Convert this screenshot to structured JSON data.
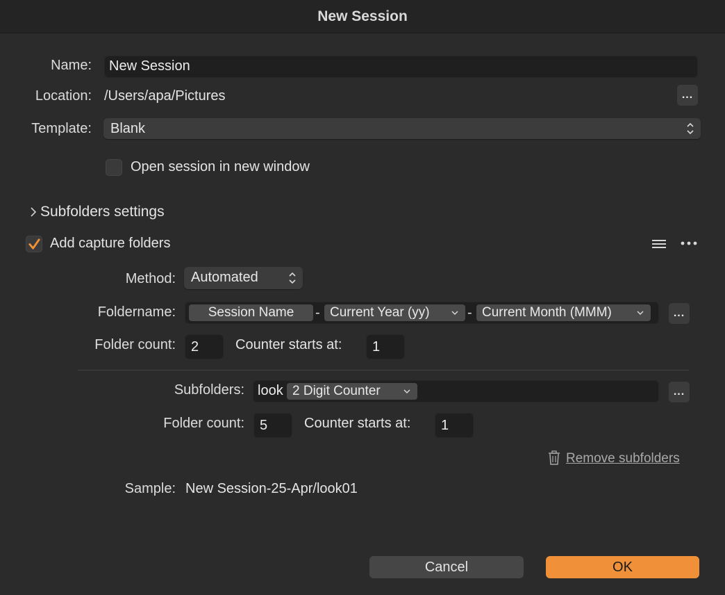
{
  "window": {
    "title": "New Session"
  },
  "form": {
    "name_label": "Name:",
    "name_value": "New Session",
    "location_label": "Location:",
    "location_value": "/Users/apa/Pictures",
    "template_label": "Template:",
    "template_value": "Blank",
    "open_new_window_label": "Open session in new window",
    "open_new_window_checked": false,
    "browse_label": "..."
  },
  "subfolders_settings": {
    "label": "Subfolders settings",
    "expanded": false
  },
  "capture": {
    "add_label": "Add capture folders",
    "checked": true,
    "method_label": "Method:",
    "method_value": "Automated",
    "foldername_label": "Foldername:",
    "tokens": [
      "Session Name",
      "Current Year (yy)",
      "Current Month (MMM)"
    ],
    "separator": "-",
    "folder_count_label": "Folder count:",
    "folder_count": "2",
    "counter_starts_label": "Counter starts at:",
    "counter_starts": "1"
  },
  "subfolders": {
    "label": "Subfolders:",
    "prefix": "look",
    "token": "2 Digit Counter",
    "folder_count_label": "Folder count:",
    "folder_count": "5",
    "counter_starts_label": "Counter starts at:",
    "counter_starts": "1",
    "remove_label": "Remove subfolders"
  },
  "sample": {
    "label": "Sample:",
    "value": "New Session-25-Apr/look01"
  },
  "buttons": {
    "cancel": "Cancel",
    "ok": "OK"
  },
  "colors": {
    "accent": "#f0913a",
    "background": "#2b2b2b"
  }
}
